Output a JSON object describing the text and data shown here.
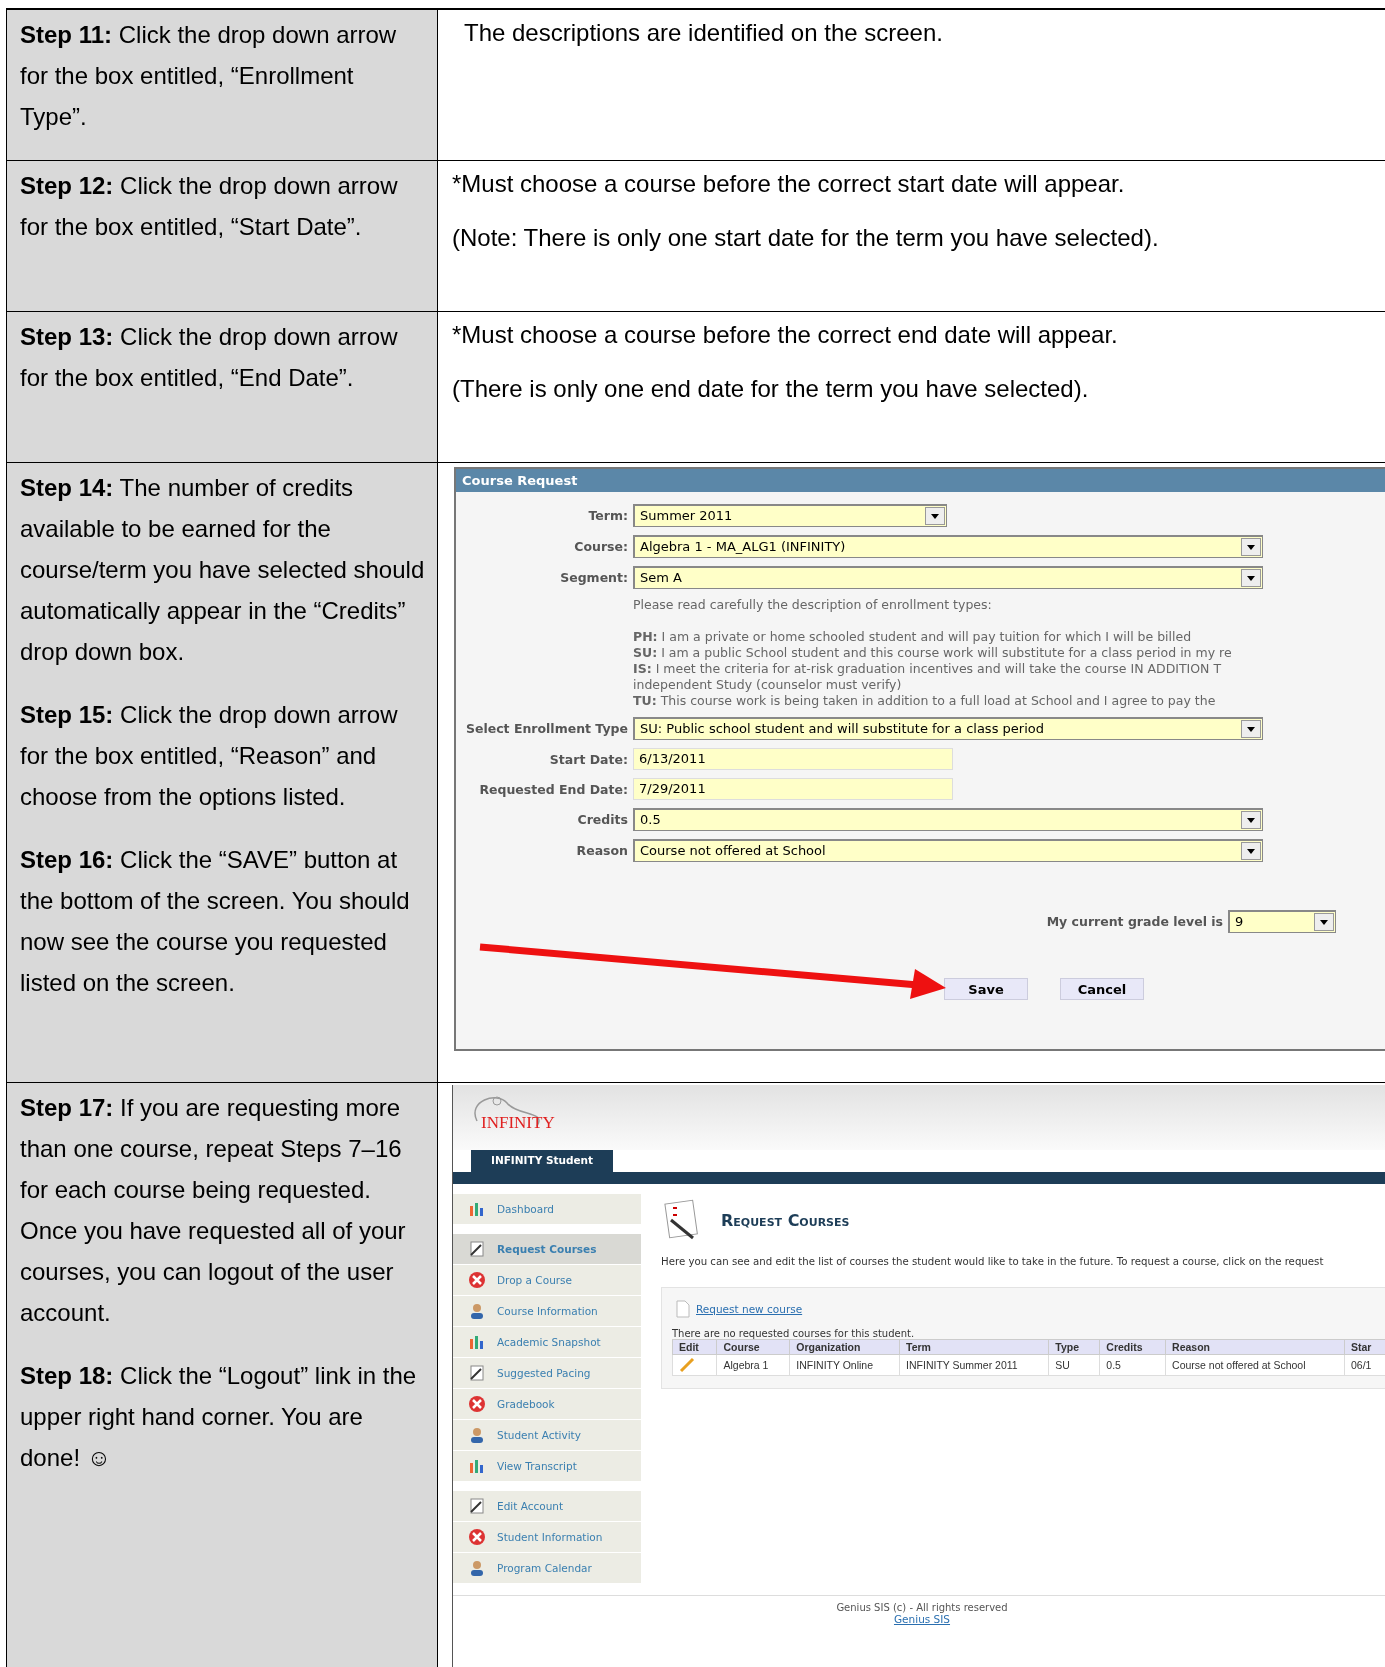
{
  "steps_table": {
    "rows": [
      {
        "instructions": [
          "**Step 11:**  Click the drop down arrow for the box entitled, “Enrollment Type”."
        ],
        "notes": [
          "The descriptions are identified on the screen."
        ],
        "kind": "notes"
      },
      {
        "instructions": [
          "**Step 12:**   Click the drop down arrow for the box entitled, “Start Date”."
        ],
        "notes": [
          "*Must choose a course before the correct start date will appear.",
          "(Note: There is only one start date for the term you have selected)."
        ],
        "kind": "notes"
      },
      {
        "instructions": [
          "**Step 13:**   Click the drop down arrow for the box entitled, “End Date”."
        ],
        "notes": [
          "*Must choose a course before the correct end date will appear.",
          "(There is only one end date for the term you have selected)."
        ],
        "kind": "notes"
      },
      {
        "instructions": [
          "**Step 14:**  The number of credits available to be earned for the course/term you have selected should automatically appear in the “Credits” drop down box.",
          "**Step 15:**  Click the drop down arrow for the box entitled, “Reason” and choose from the options listed.",
          "**Step 16:**  Click the “SAVE” button at the bottom of the screen.   You should now see the course you requested listed on the screen."
        ],
        "kind": "course_request"
      },
      {
        "instructions": [
          "**Step 17:**  If you are requesting more than one course, repeat Steps 7–16 for each course being requested.  Once you have requested all of your courses, you can logout of the user account.",
          "**Step 18:**  Click the “Logout” link in the upper right hand corner.   You are done!  ☺"
        ],
        "kind": "student_portal"
      }
    ]
  },
  "course_request": {
    "title": "Course Request",
    "fields_top": [
      {
        "label": "Term:",
        "value": "Summer 2011",
        "kind": "short_select"
      },
      {
        "label": "Course:",
        "value": "Algebra 1 - MA_ALG1 (INFINITY)",
        "kind": "select"
      },
      {
        "label": "Segment:",
        "value": "Sem A",
        "kind": "select"
      }
    ],
    "intro": "Please read carefully the description of enrollment types:",
    "enrollment_types": [
      "**PH:** I am a private or home schooled student and will pay tuition for which I will be billed",
      "**SU:** I am a public School student and this course work will substitute for a class period in my re",
      "**IS:** I meet the criteria for at-risk graduation incentives and will take the course IN ADDITION T",
      "independent Study (counselor must verify)",
      "**TU:** This course work is being taken in addition to a full load at School and I agree to pay the"
    ],
    "fields_bottom": [
      {
        "label": "Select Enrollment Type",
        "value": "SU: Public school student and will substitute for a class period",
        "kind": "select"
      },
      {
        "label": "Start Date:",
        "value": "6/13/2011",
        "kind": "text"
      },
      {
        "label": "Requested End Date:",
        "value": "7/29/2011",
        "kind": "text"
      },
      {
        "label": "Credits",
        "value": "0.5",
        "kind": "select"
      },
      {
        "label": "Reason",
        "value": "Course not offered at School",
        "kind": "select"
      }
    ],
    "grade": {
      "label": "My current grade level is",
      "value": "9"
    },
    "buttons": [
      "Save",
      "Cancel"
    ]
  },
  "student_portal": {
    "logo": "INFINITY",
    "tab": "INFINITY Student",
    "sidebar": {
      "groups": [
        [
          {
            "label": "Dashboard",
            "selected": false
          }
        ],
        [
          {
            "label": "Request Courses",
            "selected": true
          },
          {
            "label": "Drop a Course",
            "selected": false
          },
          {
            "label": "Course Information",
            "selected": false
          },
          {
            "label": "Academic Snapshot",
            "selected": false
          },
          {
            "label": "Suggested Pacing",
            "selected": false
          },
          {
            "label": "Gradebook",
            "selected": false
          },
          {
            "label": "Student Activity",
            "selected": false
          },
          {
            "label": "View Transcript",
            "selected": false
          }
        ],
        [
          {
            "label": "Edit Account",
            "selected": false
          },
          {
            "label": "Student Information",
            "selected": false
          },
          {
            "label": "Program Calendar",
            "selected": false
          }
        ]
      ]
    },
    "page_title": "Request Courses",
    "description": "Here you can see and edit the list of courses the student would like to take in the future. To request a course, click on the request",
    "request_link": "Request new course",
    "empty_note": "There are no requested courses for this student.",
    "table": {
      "columns": [
        "Edit",
        "Course",
        "Organization",
        "Term",
        "Type",
        "Credits",
        "Reason",
        "Star"
      ],
      "rows": [
        [
          "",
          "Algebra 1",
          "INFINITY Online",
          "INFINITY Summer 2011",
          "SU",
          "0.5",
          "Course not offered at School",
          "06/1"
        ]
      ]
    },
    "footer": {
      "text": "Genius SIS (c) - All rights reserved",
      "link": "Genius SIS"
    }
  }
}
